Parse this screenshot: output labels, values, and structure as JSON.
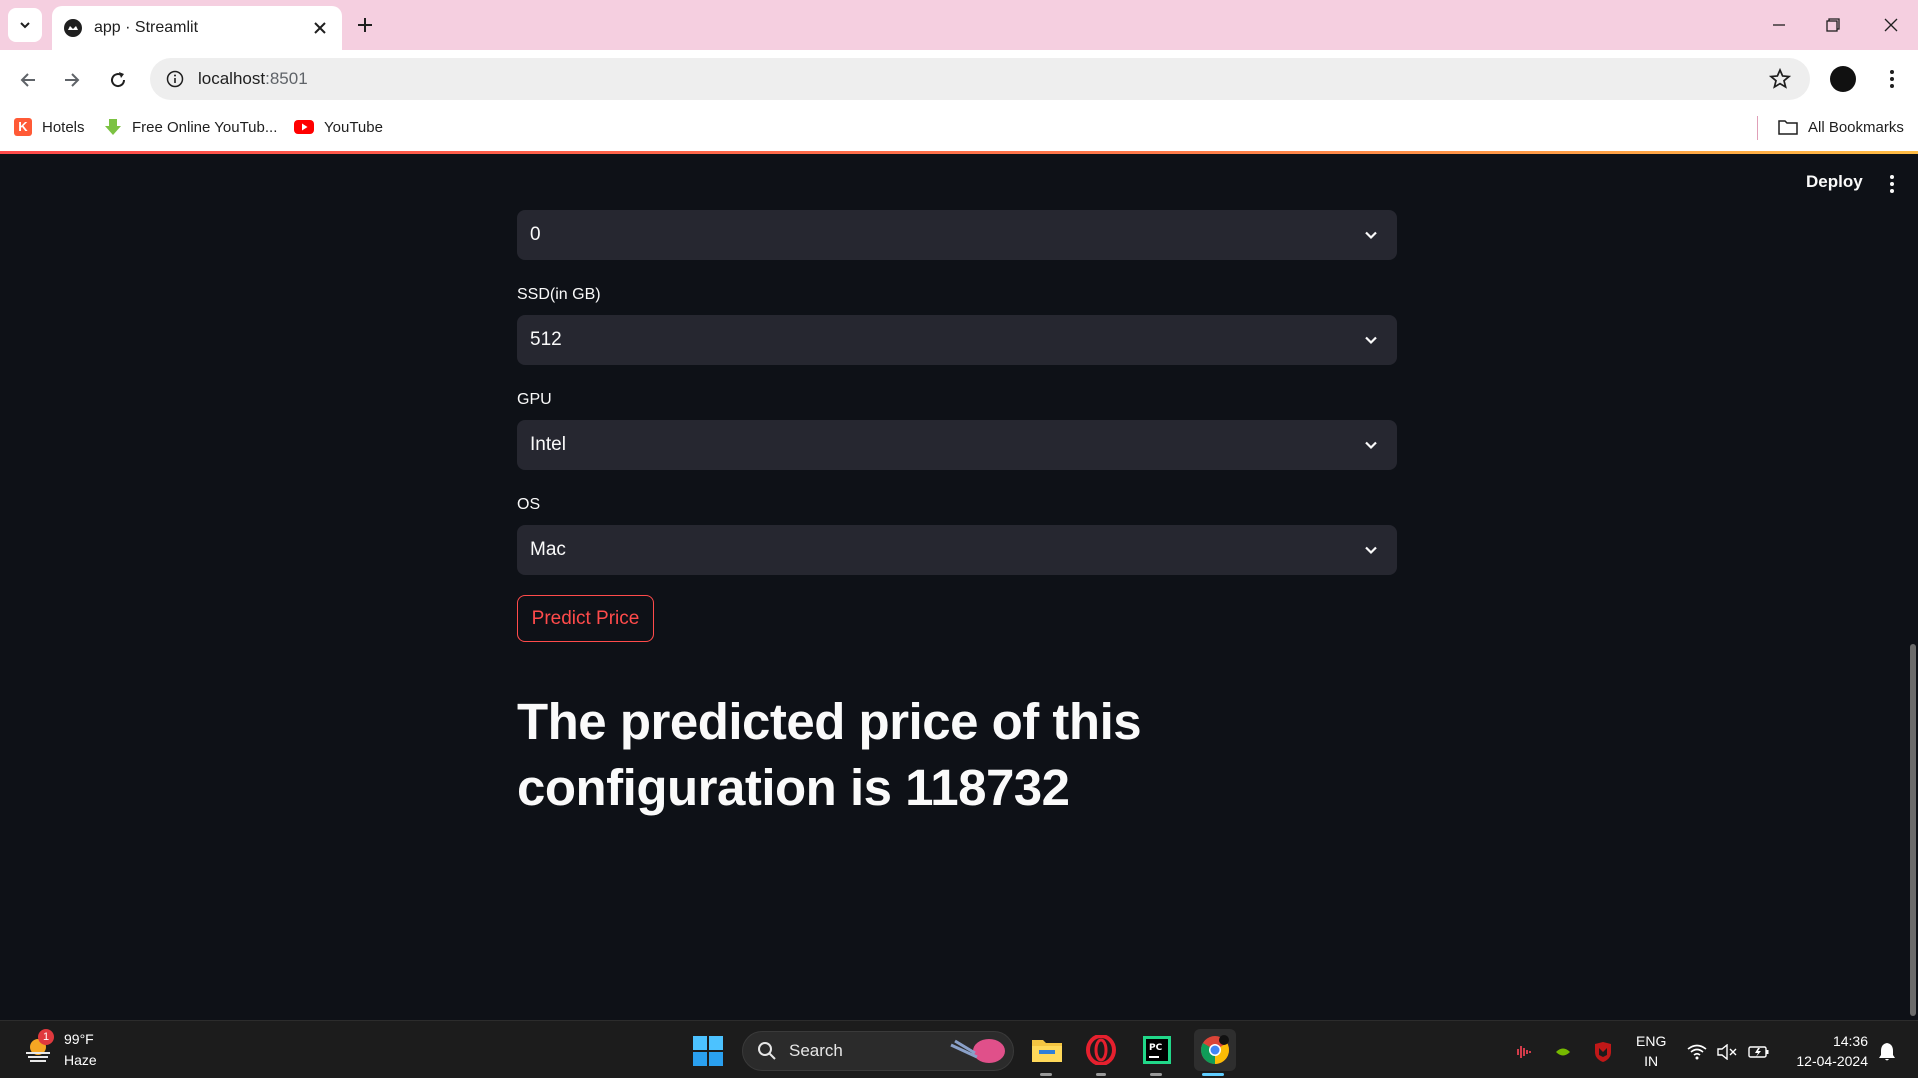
{
  "browser": {
    "tab_title": "app · Streamlit",
    "url_host": "localhost",
    "url_port": ":8501",
    "bookmarks": [
      {
        "label": "Hotels",
        "icon": "hotels-icon"
      },
      {
        "label": "Free Online YouTub...",
        "icon": "download-icon"
      },
      {
        "label": "YouTube",
        "icon": "youtube-icon"
      }
    ],
    "all_bookmarks_label": "All Bookmarks"
  },
  "app": {
    "deploy_label": "Deploy",
    "fields": [
      {
        "label": "",
        "value": "0"
      },
      {
        "label": "SSD(in GB)",
        "value": "512"
      },
      {
        "label": "GPU",
        "value": "Intel"
      },
      {
        "label": "OS",
        "value": "Mac"
      }
    ],
    "predict_button_label": "Predict Price",
    "result_text": "The predicted price of this configuration is 118732",
    "accent_color": "#ff4b4b"
  },
  "taskbar": {
    "weather_temp": "99°F",
    "weather_desc": "Haze",
    "weather_badge": "1",
    "search_label": "Search",
    "lang_line1": "ENG",
    "lang_line2": "IN",
    "time": "14:36",
    "date": "12-04-2024"
  }
}
